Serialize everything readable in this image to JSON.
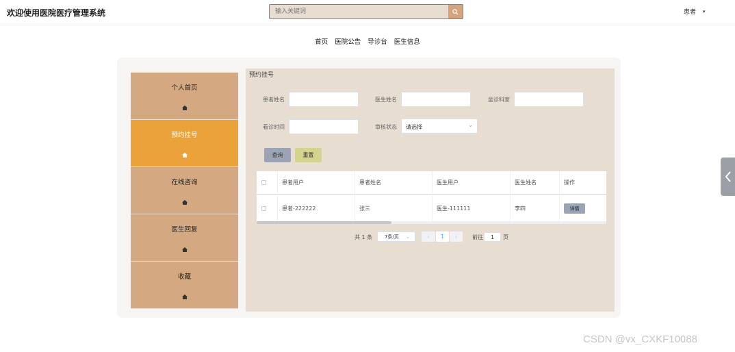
{
  "header": {
    "title": "欢迎使用医院医疗管理系统",
    "search_placeholder": "输入关键词",
    "user_label": "患者",
    "caret": "▾"
  },
  "topnav": [
    "首页",
    "医院公告",
    "导诊台",
    "医生信息"
  ],
  "sidebar": {
    "items": [
      {
        "label": "个人首页",
        "active": false,
        "icon": "home-icon"
      },
      {
        "label": "预约挂号",
        "active": true,
        "icon": "home-icon"
      },
      {
        "label": "在线咨询",
        "active": false,
        "icon": "home-icon"
      },
      {
        "label": "医生回复",
        "active": false,
        "icon": "home-icon"
      },
      {
        "label": "收藏",
        "active": false,
        "icon": "home-icon"
      }
    ]
  },
  "content": {
    "title": "预约挂号",
    "filters": {
      "patient_name_label": "患者姓名",
      "doctor_name_label": "医生姓名",
      "department_label": "坐诊科室",
      "visit_time_label": "看诊时间",
      "review_status_label": "审核状态",
      "review_status_value": "请选择"
    },
    "buttons": {
      "query": "查询",
      "reset": "重置"
    },
    "table": {
      "columns": [
        "患者用户",
        "患者姓名",
        "医生用户",
        "医生姓名",
        "操作"
      ],
      "rows": [
        {
          "patient_user": "患者-222222",
          "patient_name": "张三",
          "doctor_user": "医生-111111",
          "doctor_name": "李四",
          "action": "详情"
        }
      ]
    },
    "pagination": {
      "total_text": "共 1 条",
      "page_size": "7条/页",
      "current_page": "1",
      "prev": "‹",
      "next": "›",
      "goto_label": "前往",
      "goto_value": "1",
      "page_suffix": "页"
    }
  },
  "watermark": "CSDN @vx_CXKF10088",
  "colors": {
    "sidebar_bg": "#d4a880",
    "sidebar_active": "#eca23b",
    "content_bg": "#e8ddd1",
    "query_btn": "#9aa4b4",
    "reset_btn": "#d6d48c",
    "search_btn": "#d4a57c"
  }
}
